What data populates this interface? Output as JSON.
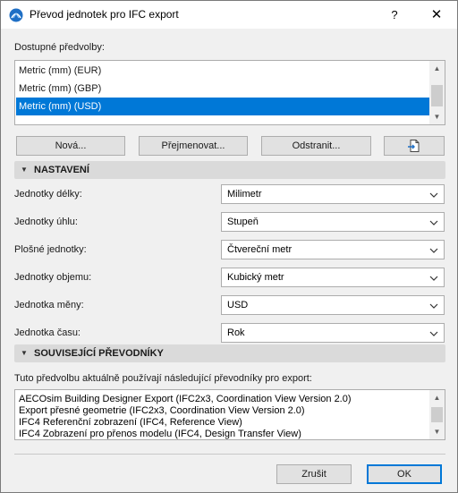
{
  "window": {
    "title": "Převod jednotek pro IFC export",
    "help_label": "?",
    "close_label": "✕"
  },
  "presets": {
    "label": "Dostupné předvolby:",
    "items": [
      {
        "label": "Metric (mm) (EUR)",
        "selected": false
      },
      {
        "label": "Metric (mm) (GBP)",
        "selected": false
      },
      {
        "label": "Metric (mm) (USD)",
        "selected": true
      }
    ],
    "buttons": {
      "new": "Nová...",
      "rename": "Přejmenovat...",
      "delete": "Odstranit..."
    }
  },
  "settings": {
    "header": "NASTAVENÍ",
    "rows": [
      {
        "label": "Jednotky délky:",
        "value": "Milimetr"
      },
      {
        "label": "Jednotky úhlu:",
        "value": "Stupeň"
      },
      {
        "label": "Plošné jednotky:",
        "value": "Čtvereční metr"
      },
      {
        "label": "Jednotky objemu:",
        "value": "Kubický metr"
      },
      {
        "label": "Jednotka měny:",
        "value": "USD"
      },
      {
        "label": "Jednotka času:",
        "value": "Rok"
      }
    ]
  },
  "converters": {
    "header": "SOUVISEJÍCÍ PŘEVODNÍKY",
    "description": "Tuto předvolbu aktuálně používají následující převodníky pro export:",
    "items": [
      "AECOsim Building Designer Export (IFC2x3, Coordination View Version 2.0)",
      "Export přesné geometrie (IFC2x3, Coordination View Version 2.0)",
      "IFC4 Referenční zobrazení (IFC4, Reference View)",
      "IFC4 Zobrazení pro přenos modelu (IFC4, Design Transfer View)"
    ]
  },
  "footer": {
    "cancel": "Zrušit",
    "ok": "OK"
  },
  "colors": {
    "selection": "#0078d7",
    "section_header": "#dadada",
    "dialog_bg": "#f0f0f0"
  },
  "icons": {
    "app": "archicad-icon",
    "import_button": "import-file-icon"
  }
}
